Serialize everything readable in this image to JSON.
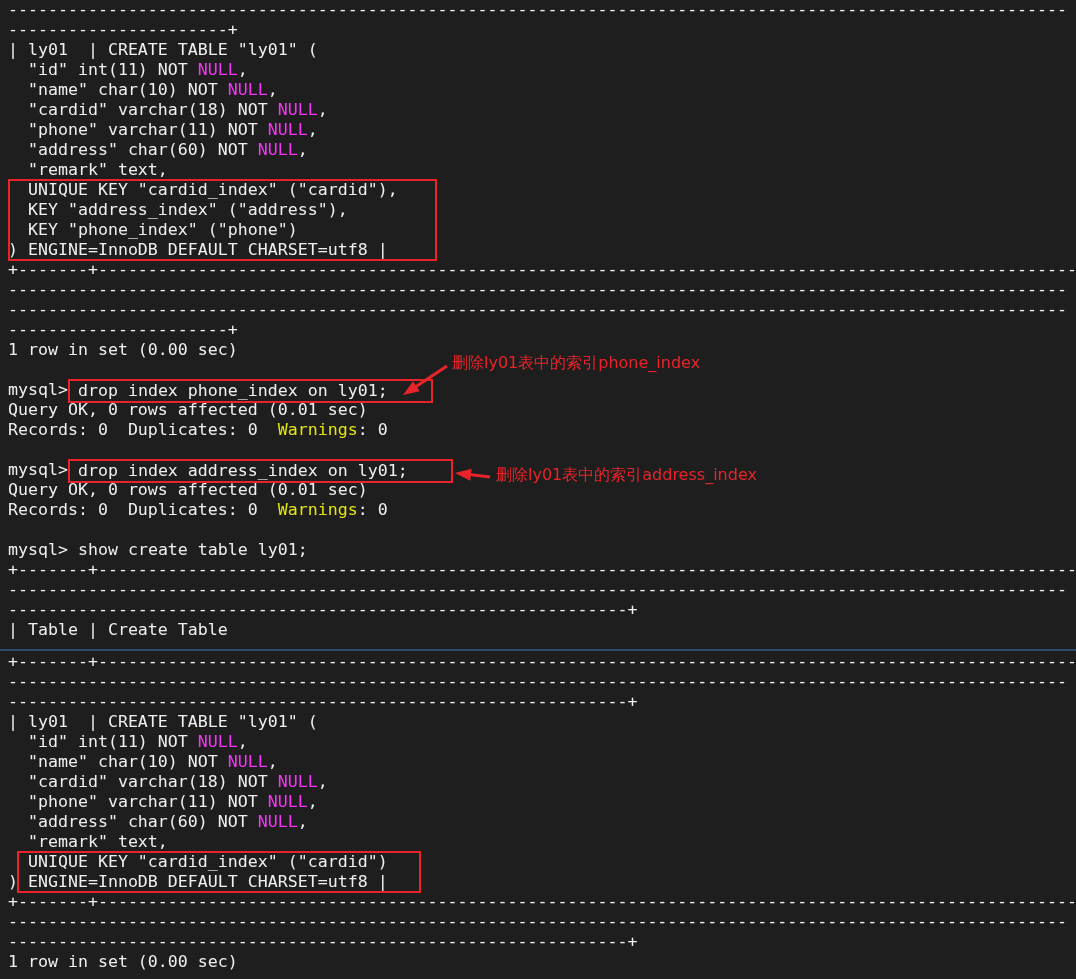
{
  "sections": [
    {
      "lines": [
        {
          "kind": "text",
          "segments": [
            {
              "kind": "plain",
              "text": "----------------------------------------------------------------------------------------------------------"
            }
          ]
        },
        {
          "kind": "text",
          "segments": [
            {
              "kind": "plain",
              "text": "----------------------+"
            }
          ]
        },
        {
          "kind": "text",
          "segments": [
            {
              "kind": "plain",
              "text": "| ly01  | CREATE TABLE \"ly01\" ("
            }
          ]
        },
        {
          "kind": "text",
          "segments": [
            {
              "kind": "plain",
              "text": "  \"id\" int(11) NOT "
            },
            {
              "kind": "null",
              "text": "NULL"
            },
            {
              "kind": "plain",
              "text": ","
            }
          ]
        },
        {
          "kind": "text",
          "segments": [
            {
              "kind": "plain",
              "text": "  \"name\" char(10) NOT "
            },
            {
              "kind": "null",
              "text": "NULL"
            },
            {
              "kind": "plain",
              "text": ","
            }
          ]
        },
        {
          "kind": "text",
          "segments": [
            {
              "kind": "plain",
              "text": "  \"cardid\" varchar(18) NOT "
            },
            {
              "kind": "null",
              "text": "NULL"
            },
            {
              "kind": "plain",
              "text": ","
            }
          ]
        },
        {
          "kind": "text",
          "segments": [
            {
              "kind": "plain",
              "text": "  \"phone\" varchar(11) NOT "
            },
            {
              "kind": "null",
              "text": "NULL"
            },
            {
              "kind": "plain",
              "text": ","
            }
          ]
        },
        {
          "kind": "text",
          "segments": [
            {
              "kind": "plain",
              "text": "  \"address\" char(60) NOT "
            },
            {
              "kind": "null",
              "text": "NULL"
            },
            {
              "kind": "plain",
              "text": ","
            }
          ]
        },
        {
          "kind": "text",
          "segments": [
            {
              "kind": "plain",
              "text": "  \"remark\" text,"
            }
          ]
        },
        {
          "kind": "text",
          "segments": [
            {
              "kind": "plain",
              "text": "  UNIQUE KEY \"cardid_index\" (\"cardid\"),"
            }
          ]
        },
        {
          "kind": "text",
          "segments": [
            {
              "kind": "plain",
              "text": "  KEY \"address_index\" (\"address\"),"
            }
          ]
        },
        {
          "kind": "text",
          "segments": [
            {
              "kind": "plain",
              "text": "  KEY \"phone_index\" (\"phone\")"
            }
          ]
        },
        {
          "kind": "text",
          "segments": [
            {
              "kind": "plain",
              "text": ") ENGINE=InnoDB DEFAULT CHARSET=utf8 |"
            }
          ]
        },
        {
          "kind": "text",
          "segments": [
            {
              "kind": "plain",
              "text": "+-------+--------------------------------------------------------------------------------------------------"
            }
          ]
        },
        {
          "kind": "text",
          "segments": [
            {
              "kind": "plain",
              "text": "----------------------------------------------------------------------------------------------------------"
            }
          ]
        },
        {
          "kind": "text",
          "segments": [
            {
              "kind": "plain",
              "text": "----------------------------------------------------------------------------------------------------------"
            }
          ]
        },
        {
          "kind": "text",
          "segments": [
            {
              "kind": "plain",
              "text": "----------------------+"
            }
          ]
        },
        {
          "kind": "text",
          "segments": [
            {
              "kind": "plain",
              "text": "1 row in set (0.00 sec)"
            }
          ]
        },
        {
          "kind": "blank"
        },
        {
          "kind": "command",
          "prompt": "mysql>",
          "command": "drop index phone_index on ly01;",
          "highlighted": true
        },
        {
          "kind": "text",
          "segments": [
            {
              "kind": "plain",
              "text": "Query OK, 0 rows affected (0.01 sec)"
            }
          ]
        },
        {
          "kind": "text",
          "segments": [
            {
              "kind": "plain",
              "text": "Records: 0  Duplicates: 0  "
            },
            {
              "kind": "warning",
              "text": "Warnings"
            },
            {
              "kind": "plain",
              "text": ": 0"
            }
          ]
        },
        {
          "kind": "blank"
        },
        {
          "kind": "command",
          "prompt": "mysql>",
          "command": "drop index address_index on ly01;",
          "highlighted": true
        },
        {
          "kind": "text",
          "segments": [
            {
              "kind": "plain",
              "text": "Query OK, 0 rows affected (0.01 sec)"
            }
          ]
        },
        {
          "kind": "text",
          "segments": [
            {
              "kind": "plain",
              "text": "Records: 0  Duplicates: 0  "
            },
            {
              "kind": "warning",
              "text": "Warnings"
            },
            {
              "kind": "plain",
              "text": ": 0"
            }
          ]
        },
        {
          "kind": "blank"
        },
        {
          "kind": "command",
          "prompt": "mysql>",
          "command": "show create table ly01;",
          "highlighted": false
        },
        {
          "kind": "text",
          "segments": [
            {
              "kind": "plain",
              "text": "+-------+--------------------------------------------------------------------------------------------------"
            }
          ]
        },
        {
          "kind": "text",
          "segments": [
            {
              "kind": "plain",
              "text": "----------------------------------------------------------------------------------------------------------"
            }
          ]
        },
        {
          "kind": "text",
          "segments": [
            {
              "kind": "plain",
              "text": "--------------------------------------------------------------+"
            }
          ]
        },
        {
          "kind": "text",
          "segments": [
            {
              "kind": "plain",
              "text": "| Table | Create Table"
            }
          ]
        }
      ]
    },
    {
      "lines": [
        {
          "kind": "text",
          "segments": [
            {
              "kind": "plain",
              "text": "+-------+--------------------------------------------------------------------------------------------------"
            }
          ]
        },
        {
          "kind": "text",
          "segments": [
            {
              "kind": "plain",
              "text": "----------------------------------------------------------------------------------------------------------"
            }
          ]
        },
        {
          "kind": "text",
          "segments": [
            {
              "kind": "plain",
              "text": "--------------------------------------------------------------+"
            }
          ]
        },
        {
          "kind": "text",
          "segments": [
            {
              "kind": "plain",
              "text": "| ly01  | CREATE TABLE \"ly01\" ("
            }
          ]
        },
        {
          "kind": "text",
          "segments": [
            {
              "kind": "plain",
              "text": "  \"id\" int(11) NOT "
            },
            {
              "kind": "null",
              "text": "NULL"
            },
            {
              "kind": "plain",
              "text": ","
            }
          ]
        },
        {
          "kind": "text",
          "segments": [
            {
              "kind": "plain",
              "text": "  \"name\" char(10) NOT "
            },
            {
              "kind": "null",
              "text": "NULL"
            },
            {
              "kind": "plain",
              "text": ","
            }
          ]
        },
        {
          "kind": "text",
          "segments": [
            {
              "kind": "plain",
              "text": "  \"cardid\" varchar(18) NOT "
            },
            {
              "kind": "null",
              "text": "NULL"
            },
            {
              "kind": "plain",
              "text": ","
            }
          ]
        },
        {
          "kind": "text",
          "segments": [
            {
              "kind": "plain",
              "text": "  \"phone\" varchar(11) NOT "
            },
            {
              "kind": "null",
              "text": "NULL"
            },
            {
              "kind": "plain",
              "text": ","
            }
          ]
        },
        {
          "kind": "text",
          "segments": [
            {
              "kind": "plain",
              "text": "  \"address\" char(60) NOT "
            },
            {
              "kind": "null",
              "text": "NULL"
            },
            {
              "kind": "plain",
              "text": ","
            }
          ]
        },
        {
          "kind": "text",
          "segments": [
            {
              "kind": "plain",
              "text": "  \"remark\" text,"
            }
          ]
        },
        {
          "kind": "text",
          "segments": [
            {
              "kind": "plain",
              "text": "  UNIQUE KEY \"cardid_index\" (\"cardid\")"
            }
          ]
        },
        {
          "kind": "text",
          "segments": [
            {
              "kind": "plain",
              "text": ") ENGINE=InnoDB DEFAULT CHARSET=utf8 |"
            }
          ]
        },
        {
          "kind": "text",
          "segments": [
            {
              "kind": "plain",
              "text": "+-------+--------------------------------------------------------------------------------------------------"
            }
          ]
        },
        {
          "kind": "text",
          "segments": [
            {
              "kind": "plain",
              "text": "----------------------------------------------------------------------------------------------------------"
            }
          ]
        },
        {
          "kind": "text",
          "segments": [
            {
              "kind": "plain",
              "text": "--------------------------------------------------------------+"
            }
          ]
        },
        {
          "kind": "text",
          "segments": [
            {
              "kind": "plain",
              "text": "1 row in set (0.00 sec)"
            }
          ]
        }
      ]
    }
  ],
  "annotations": [
    {
      "text": "删除ly01表中的索引phone_index"
    },
    {
      "text": "删除ly01表中的索引address_index"
    }
  ]
}
